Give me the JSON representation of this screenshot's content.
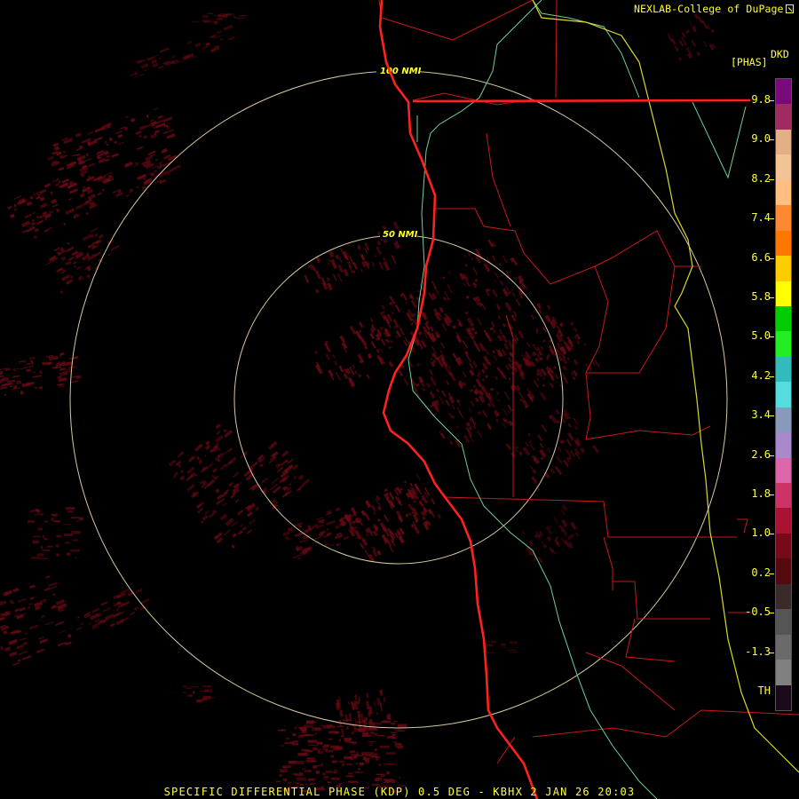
{
  "credit": "NEXLAB-College of DuPage",
  "legend": {
    "unit": "DKD",
    "quantity": "[PHAS]",
    "labels": [
      "9.8",
      "9.0",
      "8.2",
      "7.4",
      "6.6",
      "5.8",
      "5.0",
      "4.2",
      "3.4",
      "2.6",
      "1.8",
      "1.0",
      "0.2",
      "-0.5",
      "-1.3",
      "TH"
    ],
    "colors": [
      "#7a0a7a",
      "#a02a62",
      "#e3b085",
      "#f2c394",
      "#ffbf80",
      "#ff8833",
      "#ff7700",
      "#ffcc00",
      "#ffff00",
      "#00cc00",
      "#22ee22",
      "#33bbbb",
      "#55dddd",
      "#8899bb",
      "#aa88cc",
      "#dd66aa",
      "#cc3366",
      "#aa1133",
      "#770a1a",
      "#550a10",
      "#3a2a2a",
      "#555555",
      "#6a6a6a",
      "#808080",
      "#1a0a1a"
    ]
  },
  "range_rings": [
    "100 NMI",
    "50 NMI"
  ],
  "footer": "SPECIFIC DIFFERENTIAL PHASE (KDP) 0.5 DEG - KBHX 2 JAN 26 20:03",
  "map_colors": {
    "echo": "#6a0a14",
    "coastline": "#ff2020",
    "county_lines": "#c81818",
    "rivers": "#70d098",
    "state_line": "#d8d830",
    "range_ring": "#d8c8a0"
  }
}
